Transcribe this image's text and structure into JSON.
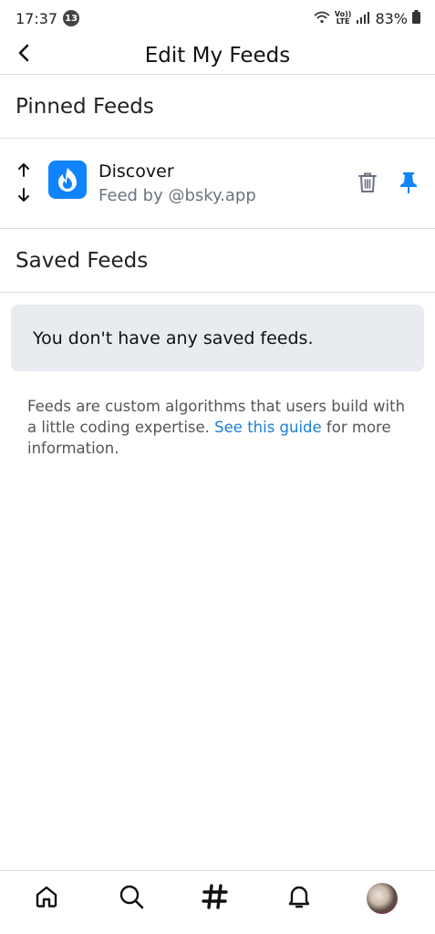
{
  "status_bar": {
    "time": "17:37",
    "notification_count": "13",
    "network_top": "Vo))",
    "network_bottom": "LTE",
    "battery": "83%"
  },
  "header": {
    "title": "Edit My Feeds",
    "back_icon": "chevron-left-icon"
  },
  "pinned_section": {
    "title": "Pinned Feeds",
    "feeds": [
      {
        "name": "Discover",
        "owner": "Feed by @bsky.app",
        "icon": "discover-flame-icon",
        "icon_bg": "#1083fe"
      }
    ]
  },
  "saved_section": {
    "title": "Saved Feeds",
    "empty_message": "You don't have any saved feeds."
  },
  "info": {
    "text_before": "Feeds are custom algorithms that users build with a little coding expertise. ",
    "link_text": "See this guide",
    "text_after": " for more information."
  },
  "colors": {
    "accent": "#1083fe",
    "link": "#1a7fd6",
    "empty_bg": "#e8ebef",
    "divider": "#dcdcdc"
  },
  "bottom_nav": [
    "home-icon",
    "search-icon",
    "hashtag-icon",
    "notifications-icon",
    "profile-avatar"
  ]
}
